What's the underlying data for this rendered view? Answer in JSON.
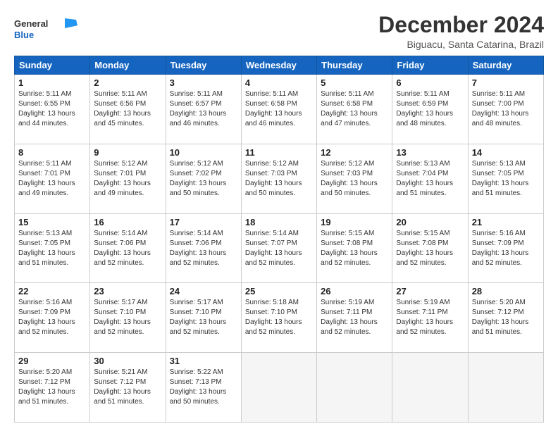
{
  "header": {
    "logo_general": "General",
    "logo_blue": "Blue",
    "month_title": "December 2024",
    "subtitle": "Biguacu, Santa Catarina, Brazil"
  },
  "days_of_week": [
    "Sunday",
    "Monday",
    "Tuesday",
    "Wednesday",
    "Thursday",
    "Friday",
    "Saturday"
  ],
  "weeks": [
    [
      {
        "num": "1",
        "rise": "5:11 AM",
        "set": "6:55 PM",
        "hours": "13 hours",
        "mins": "44 minutes."
      },
      {
        "num": "2",
        "rise": "5:11 AM",
        "set": "6:56 PM",
        "hours": "13 hours",
        "mins": "45 minutes."
      },
      {
        "num": "3",
        "rise": "5:11 AM",
        "set": "6:57 PM",
        "hours": "13 hours",
        "mins": "46 minutes."
      },
      {
        "num": "4",
        "rise": "5:11 AM",
        "set": "6:58 PM",
        "hours": "13 hours",
        "mins": "46 minutes."
      },
      {
        "num": "5",
        "rise": "5:11 AM",
        "set": "6:58 PM",
        "hours": "13 hours",
        "mins": "47 minutes."
      },
      {
        "num": "6",
        "rise": "5:11 AM",
        "set": "6:59 PM",
        "hours": "13 hours",
        "mins": "48 minutes."
      },
      {
        "num": "7",
        "rise": "5:11 AM",
        "set": "7:00 PM",
        "hours": "13 hours",
        "mins": "48 minutes."
      }
    ],
    [
      {
        "num": "8",
        "rise": "5:11 AM",
        "set": "7:01 PM",
        "hours": "13 hours",
        "mins": "49 minutes."
      },
      {
        "num": "9",
        "rise": "5:12 AM",
        "set": "7:01 PM",
        "hours": "13 hours",
        "mins": "49 minutes."
      },
      {
        "num": "10",
        "rise": "5:12 AM",
        "set": "7:02 PM",
        "hours": "13 hours",
        "mins": "50 minutes."
      },
      {
        "num": "11",
        "rise": "5:12 AM",
        "set": "7:03 PM",
        "hours": "13 hours",
        "mins": "50 minutes."
      },
      {
        "num": "12",
        "rise": "5:12 AM",
        "set": "7:03 PM",
        "hours": "13 hours",
        "mins": "50 minutes."
      },
      {
        "num": "13",
        "rise": "5:13 AM",
        "set": "7:04 PM",
        "hours": "13 hours",
        "mins": "51 minutes."
      },
      {
        "num": "14",
        "rise": "5:13 AM",
        "set": "7:05 PM",
        "hours": "13 hours",
        "mins": "51 minutes."
      }
    ],
    [
      {
        "num": "15",
        "rise": "5:13 AM",
        "set": "7:05 PM",
        "hours": "13 hours",
        "mins": "51 minutes."
      },
      {
        "num": "16",
        "rise": "5:14 AM",
        "set": "7:06 PM",
        "hours": "13 hours",
        "mins": "52 minutes."
      },
      {
        "num": "17",
        "rise": "5:14 AM",
        "set": "7:06 PM",
        "hours": "13 hours",
        "mins": "52 minutes."
      },
      {
        "num": "18",
        "rise": "5:14 AM",
        "set": "7:07 PM",
        "hours": "13 hours",
        "mins": "52 minutes."
      },
      {
        "num": "19",
        "rise": "5:15 AM",
        "set": "7:08 PM",
        "hours": "13 hours",
        "mins": "52 minutes."
      },
      {
        "num": "20",
        "rise": "5:15 AM",
        "set": "7:08 PM",
        "hours": "13 hours",
        "mins": "52 minutes."
      },
      {
        "num": "21",
        "rise": "5:16 AM",
        "set": "7:09 PM",
        "hours": "13 hours",
        "mins": "52 minutes."
      }
    ],
    [
      {
        "num": "22",
        "rise": "5:16 AM",
        "set": "7:09 PM",
        "hours": "13 hours",
        "mins": "52 minutes."
      },
      {
        "num": "23",
        "rise": "5:17 AM",
        "set": "7:10 PM",
        "hours": "13 hours",
        "mins": "52 minutes."
      },
      {
        "num": "24",
        "rise": "5:17 AM",
        "set": "7:10 PM",
        "hours": "13 hours",
        "mins": "52 minutes."
      },
      {
        "num": "25",
        "rise": "5:18 AM",
        "set": "7:10 PM",
        "hours": "13 hours",
        "mins": "52 minutes."
      },
      {
        "num": "26",
        "rise": "5:19 AM",
        "set": "7:11 PM",
        "hours": "13 hours",
        "mins": "52 minutes."
      },
      {
        "num": "27",
        "rise": "5:19 AM",
        "set": "7:11 PM",
        "hours": "13 hours",
        "mins": "52 minutes."
      },
      {
        "num": "28",
        "rise": "5:20 AM",
        "set": "7:12 PM",
        "hours": "13 hours",
        "mins": "51 minutes."
      }
    ],
    [
      {
        "num": "29",
        "rise": "5:20 AM",
        "set": "7:12 PM",
        "hours": "13 hours",
        "mins": "51 minutes."
      },
      {
        "num": "30",
        "rise": "5:21 AM",
        "set": "7:12 PM",
        "hours": "13 hours",
        "mins": "51 minutes."
      },
      {
        "num": "31",
        "rise": "5:22 AM",
        "set": "7:13 PM",
        "hours": "13 hours",
        "mins": "50 minutes."
      },
      null,
      null,
      null,
      null
    ]
  ]
}
